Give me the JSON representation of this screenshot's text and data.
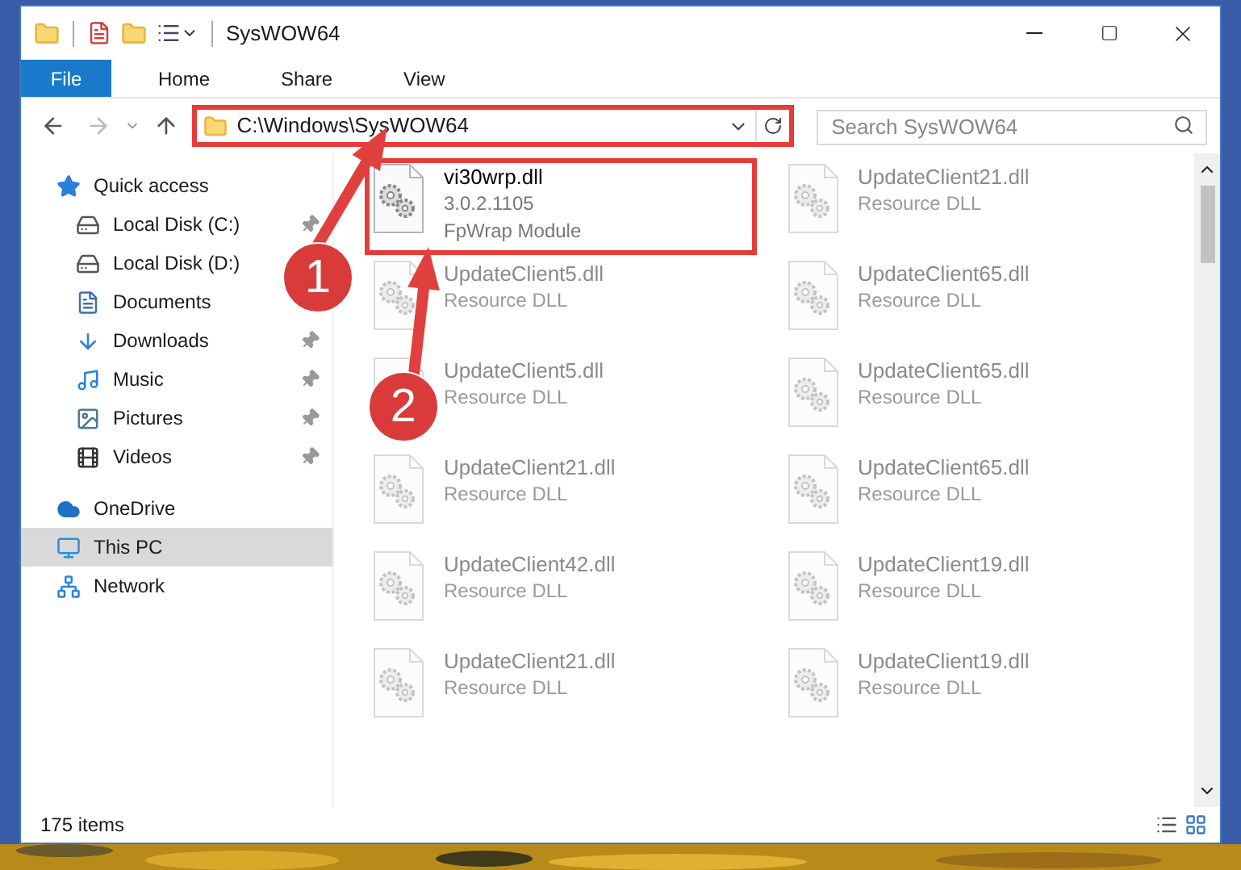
{
  "window": {
    "title": "SysWOW64"
  },
  "ribbon_tabs": [
    {
      "label": "File",
      "kind": "file"
    },
    {
      "label": "Home",
      "kind": "tab"
    },
    {
      "label": "Share",
      "kind": "tab"
    },
    {
      "label": "View",
      "kind": "tab"
    }
  ],
  "address_bar": {
    "path": "C:\\Windows\\SysWOW64",
    "highlighted": true
  },
  "search": {
    "placeholder": "Search SysWOW64"
  },
  "sidebar": {
    "items": [
      {
        "label": "Quick access",
        "kind": "star",
        "selected": false,
        "children": [
          {
            "label": "Local Disk (C:)",
            "kind": "drive",
            "pinned": true,
            "selected": false
          },
          {
            "label": "Local Disk (D:)",
            "kind": "drive",
            "pinned": false,
            "selected": false
          },
          {
            "label": "Documents",
            "kind": "documents",
            "pinned": false,
            "selected": false
          },
          {
            "label": "Downloads",
            "kind": "downloads",
            "pinned": true,
            "selected": false
          },
          {
            "label": "Music",
            "kind": "music",
            "pinned": true,
            "selected": false
          },
          {
            "label": "Pictures",
            "kind": "pictures",
            "pinned": true,
            "selected": false
          },
          {
            "label": "Videos",
            "kind": "videos",
            "pinned": true,
            "selected": false
          }
        ]
      },
      {
        "label": "OneDrive",
        "kind": "cloud",
        "selected": false
      },
      {
        "label": "This PC",
        "kind": "pc",
        "selected": true
      },
      {
        "label": "Network",
        "kind": "network",
        "selected": false
      }
    ]
  },
  "files": [
    {
      "name": "vi30wrp.dll",
      "details": [
        "3.0.2.1105",
        "FpWrap Module"
      ],
      "highlighted": true,
      "blurred": false
    },
    {
      "name": "UpdateClient21.dll",
      "details": [
        "Resource DLL"
      ],
      "highlighted": false,
      "blurred": true
    },
    {
      "name": "UpdateClient5.dll",
      "details": [
        "Resource DLL"
      ],
      "highlighted": false,
      "blurred": true
    },
    {
      "name": "UpdateClient65.dll",
      "details": [
        "Resource DLL"
      ],
      "highlighted": false,
      "blurred": true
    },
    {
      "name": "UpdateClient5.dll",
      "details": [
        "Resource DLL"
      ],
      "highlighted": false,
      "blurred": true
    },
    {
      "name": "UpdateClient65.dll",
      "details": [
        "Resource DLL"
      ],
      "highlighted": false,
      "blurred": true
    },
    {
      "name": "UpdateClient21.dll",
      "details": [
        "Resource DLL"
      ],
      "highlighted": false,
      "blurred": true
    },
    {
      "name": "UpdateClient65.dll",
      "details": [
        "Resource DLL"
      ],
      "highlighted": false,
      "blurred": true
    },
    {
      "name": "UpdateClient42.dll",
      "details": [
        "Resource DLL"
      ],
      "highlighted": false,
      "blurred": true
    },
    {
      "name": "UpdateClient19.dll",
      "details": [
        "Resource DLL"
      ],
      "highlighted": false,
      "blurred": true
    },
    {
      "name": "UpdateClient21.dll",
      "details": [
        "Resource DLL"
      ],
      "highlighted": false,
      "blurred": true
    },
    {
      "name": "UpdateClient19.dll",
      "details": [
        "Resource DLL"
      ],
      "highlighted": false,
      "blurred": true
    }
  ],
  "status_bar": {
    "item_count": "175 items"
  },
  "callouts": [
    {
      "label": "1"
    },
    {
      "label": "2"
    }
  ]
}
